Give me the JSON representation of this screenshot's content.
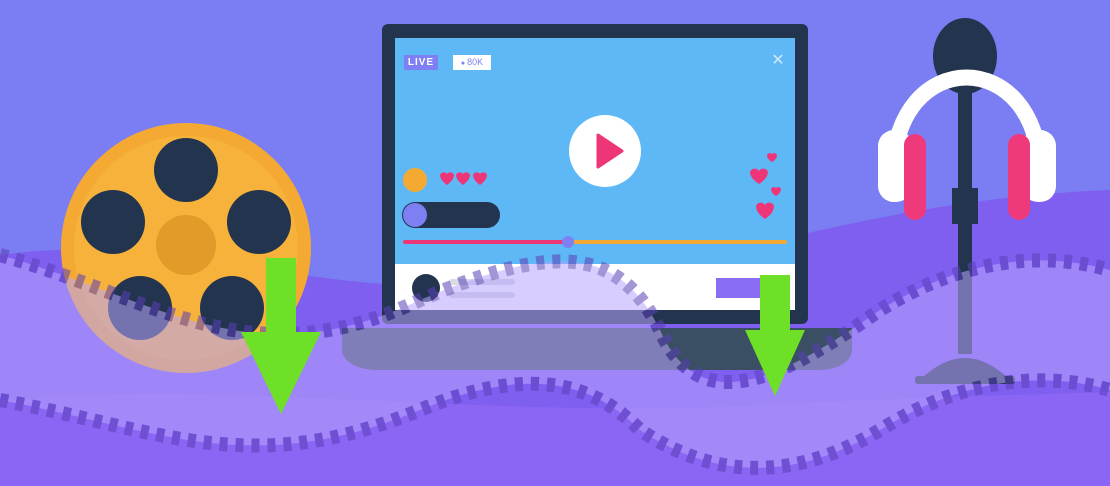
{
  "player": {
    "live_label": "LIVE",
    "viewers_label": "80K",
    "viewers_icon": "eye-icon",
    "close_icon": "close-icon",
    "play_icon": "play-icon",
    "progress_fraction": 0.43
  },
  "colors": {
    "background": "#7a7ef2",
    "wave": "#7f5ff0",
    "screen": "#5fb8f6",
    "device": "#22344e",
    "heart": "#ee3577",
    "reel": "#f4aa32",
    "arrow": "#6fe028",
    "headphone_cup": "#ee3a7b"
  }
}
